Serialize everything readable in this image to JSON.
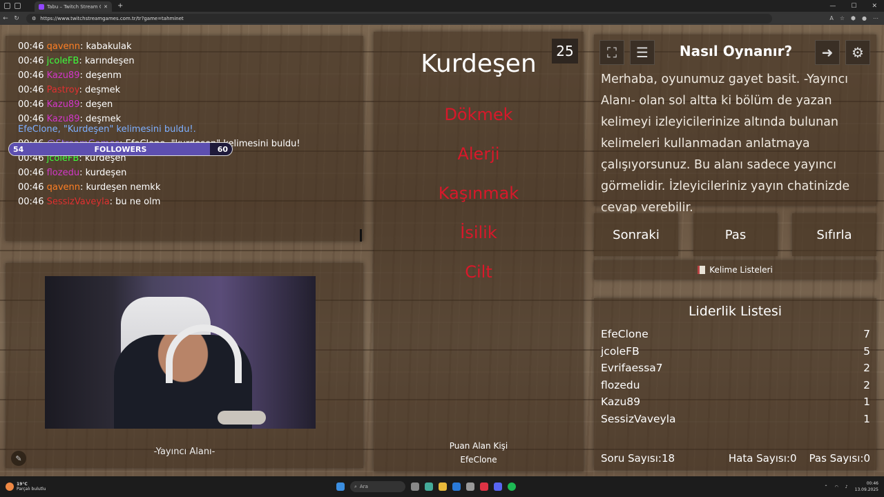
{
  "browser": {
    "tab_title": "Tabu – Twitch Stream Games",
    "url": "https://www.twitchstreamgames.com.tr/tr?game=tahminet"
  },
  "chat": {
    "lines": [
      {
        "time": "00:46",
        "user": "qavenn",
        "color": "#ff7f24",
        "msg": ": kabakulak"
      },
      {
        "time": "00:46",
        "user": "jcoleFB",
        "color": "#3dff3d",
        "msg": ": karındeşen"
      },
      {
        "time": "00:46",
        "user": "Kazu89",
        "color": "#d236c8",
        "msg": ": deşenm"
      },
      {
        "time": "00:46",
        "user": "Pastroy",
        "color": "#e03030",
        "msg": ": deşmek"
      },
      {
        "time": "00:46",
        "user": "Kazu89",
        "color": "#d236c8",
        "msg": ": deşen"
      },
      {
        "time": "00:46",
        "user": "Kazu89",
        "color": "#d236c8",
        "msg": ": deşmek"
      }
    ],
    "notice": "EfeClone, \"Kurdeşen\" kelimesini buldu!.",
    "lines2": [
      {
        "time": "00:46",
        "user": "@StreamGames",
        "color": "#9b6cff",
        "msg": ": EfeClone, \"kurdeşen\" kelimesini buldu!"
      },
      {
        "time": "00:46",
        "user": "jcoleFB",
        "color": "#3dff3d",
        "msg": ": kurdeşen"
      },
      {
        "time": "00:46",
        "user": "flozedu",
        "color": "#d236c8",
        "msg": ": kurdeşen"
      },
      {
        "time": "00:46",
        "user": "qavenn",
        "color": "#ff7f24",
        "msg": ": kurdeşen nemkk"
      },
      {
        "time": "00:46",
        "user": "SessizVaveyla",
        "color": "#e03030",
        "msg": ": bu ne olm"
      }
    ]
  },
  "followers": {
    "current": "54",
    "label": "FOLLOWERS",
    "goal": "60",
    "progress": 0.9
  },
  "streamer": {
    "label": "-Yayıncı Alanı-"
  },
  "game": {
    "word": "Kurdeşen",
    "timer": "25",
    "taboo": [
      "Dökmek",
      "Alerji",
      "Kaşınmak",
      "İsilik",
      "Cilt"
    ],
    "scorer_label": "Puan Alan Kişi",
    "scorer": "EfeClone"
  },
  "howto": {
    "title": "Nasıl Oynanır?",
    "text": "Merhaba, oyunumuz gayet basit. -Yayıncı Alanı- olan sol altta ki bölüm de yazan kelimeyi izleyicilerinize altında bulunan kelimeleri kullanmadan anlatmaya çalışıyorsunuz. Bu alanı sadece yayıncı görmelidir. İzleyicileriniz yayın chatinizde cevap verebilir."
  },
  "actions": {
    "next": "Sonraki",
    "pass": "Pas",
    "reset": "Sıfırla",
    "lists": "Kelime Listeleri"
  },
  "leaderboard": {
    "title": "Liderlik Listesi",
    "rows": [
      {
        "name": "EfeClone",
        "score": "7"
      },
      {
        "name": "jcoleFB",
        "score": "5"
      },
      {
        "name": "Evrifaessa7",
        "score": "2"
      },
      {
        "name": "flozedu",
        "score": "2"
      },
      {
        "name": "Kazu89",
        "score": "1"
      },
      {
        "name": "SessizVaveyla",
        "score": "1"
      }
    ],
    "q_label": "Soru Sayısı:",
    "q": "18",
    "err_label": "Hata Sayısı:",
    "err": "0",
    "pass_label": "Pas Sayısı:",
    "pass": "0"
  },
  "taskbar": {
    "temp": "19°C",
    "weather": "Parçalı bulutlu",
    "search": "Ara",
    "time": "00:46",
    "date": "13.09.2025"
  }
}
